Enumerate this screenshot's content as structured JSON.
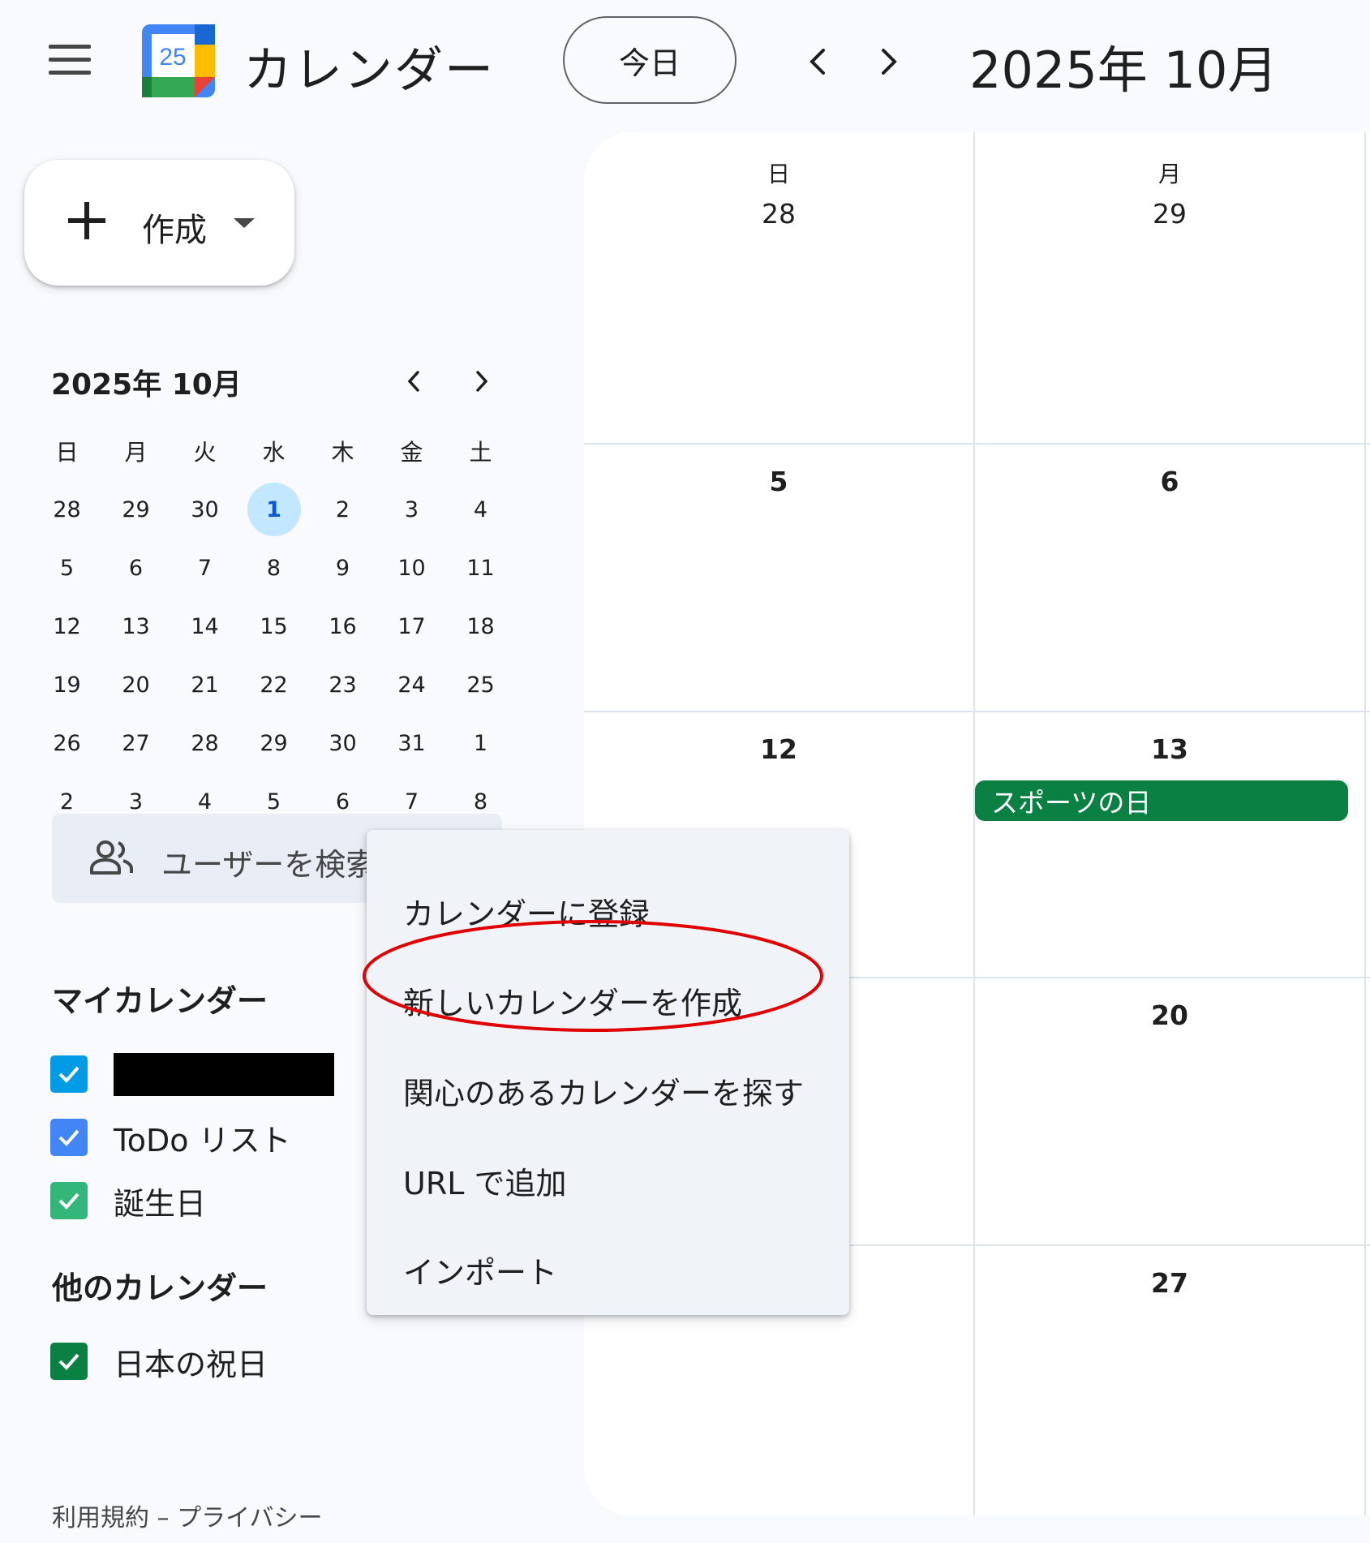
{
  "header": {
    "app_title": "カレンダー",
    "logo_number": "25",
    "today_label": "今日",
    "title": "2025年 10月"
  },
  "create": {
    "label": "作成"
  },
  "mini_calendar": {
    "title": "2025年 10月",
    "weekdays": [
      "日",
      "月",
      "火",
      "水",
      "木",
      "金",
      "土"
    ],
    "weeks": [
      [
        "28",
        "29",
        "30",
        "1",
        "2",
        "3",
        "4"
      ],
      [
        "5",
        "6",
        "7",
        "8",
        "9",
        "10",
        "11"
      ],
      [
        "12",
        "13",
        "14",
        "15",
        "16",
        "17",
        "18"
      ],
      [
        "19",
        "20",
        "21",
        "22",
        "23",
        "24",
        "25"
      ],
      [
        "26",
        "27",
        "28",
        "29",
        "30",
        "31",
        "1"
      ],
      [
        "2",
        "3",
        "4",
        "5",
        "6",
        "7",
        "8"
      ]
    ],
    "today": "1"
  },
  "search_users": {
    "placeholder": "ユーザーを検索"
  },
  "my_calendars": {
    "title": "マイカレンダー",
    "items": [
      {
        "label": "",
        "color": "#039be5",
        "redacted": true
      },
      {
        "label": "ToDo リスト",
        "color": "#4285f4"
      },
      {
        "label": "誕生日",
        "color": "#33b679"
      }
    ]
  },
  "other_calendars": {
    "title": "他のカレンダー",
    "items": [
      {
        "label": "日本の祝日",
        "color": "#0b8043"
      }
    ]
  },
  "footer": {
    "links": "利用規約 – プライバシー"
  },
  "month_view": {
    "columns": [
      {
        "weekday": "日",
        "dates": [
          "28",
          "5",
          "12",
          "",
          "",
          ""
        ]
      },
      {
        "weekday": "月",
        "dates": [
          "29",
          "6",
          "13",
          "20",
          "27"
        ]
      }
    ],
    "event": {
      "label": "スポーツの日",
      "color": "#0b8043"
    }
  },
  "menu": {
    "items": [
      "カレンダーに登録",
      "新しいカレンダーを作成",
      "関心のあるカレンダーを探す",
      "URL で追加",
      "インポート"
    ],
    "highlight_color": "#e00000"
  },
  "colors": {
    "accent": "#0b57d0",
    "today_bg": "#c2e7ff",
    "background": "#f8fafd"
  }
}
